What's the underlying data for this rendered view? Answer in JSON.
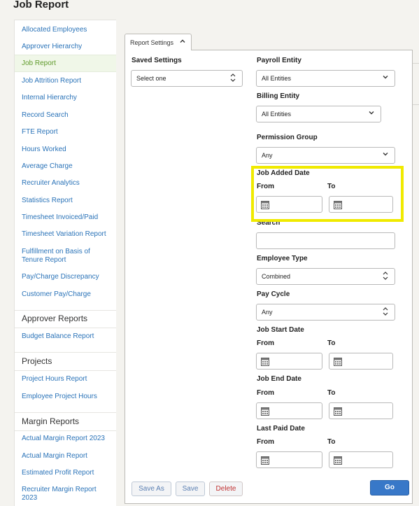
{
  "page": {
    "title": "Job Report"
  },
  "sidebar": {
    "items": [
      {
        "label": "Allocated Employees"
      },
      {
        "label": "Approver Hierarchy"
      },
      {
        "label": "Job Report"
      },
      {
        "label": "Job Attrition Report"
      },
      {
        "label": "Internal Hierarchy"
      },
      {
        "label": "Record Search"
      },
      {
        "label": "FTE Report"
      },
      {
        "label": "Hours Worked"
      },
      {
        "label": "Average Charge"
      },
      {
        "label": "Recruiter Analytics"
      },
      {
        "label": "Statistics Report"
      },
      {
        "label": "Timesheet Invoiced/Paid"
      },
      {
        "label": "Timesheet Variation Report"
      },
      {
        "label": "Fulfillment on Basis of Tenure Report"
      },
      {
        "label": "Pay/Charge Discrepancy"
      },
      {
        "label": "Customer Pay/Charge"
      },
      {
        "label": "Budget Balance Report"
      },
      {
        "label": "Project Hours Report"
      },
      {
        "label": "Employee Project Hours"
      },
      {
        "label": "Actual Margin Report 2023"
      },
      {
        "label": "Actual Margin Report"
      },
      {
        "label": "Estimated Profit Report"
      },
      {
        "label": "Recruiter Margin Report 2023"
      }
    ],
    "headings": [
      {
        "label": "Approver Reports"
      },
      {
        "label": "Projects"
      },
      {
        "label": "Margin Reports"
      }
    ],
    "active_color": "#5f9a2a",
    "link_color": "#2a73b8"
  },
  "tab": {
    "label": "Report Settings",
    "icon": "chevron-up-icon"
  },
  "form": {
    "saved_settings": {
      "label": "Saved Settings",
      "value": "Select one"
    },
    "payroll_entity": {
      "label": "Payroll Entity",
      "value": "All Entities"
    },
    "billing_entity": {
      "label": "Billing Entity",
      "value": "All Entities"
    },
    "permission_group": {
      "label": "Permission Group",
      "value": "Any"
    },
    "job_added_date": {
      "label": "Job Added Date",
      "from": "From",
      "to": "To"
    },
    "search": {
      "label": "Search",
      "value": ""
    },
    "employee_type": {
      "label": "Employee Type",
      "value": "Combined"
    },
    "pay_cycle": {
      "label": "Pay Cycle",
      "value": "Any"
    },
    "job_start_date": {
      "label": "Job Start Date",
      "from": "From",
      "to": "To"
    },
    "job_end_date": {
      "label": "Job End Date",
      "from": "From",
      "to": "To"
    },
    "last_paid_date": {
      "label": "Last Paid Date",
      "from": "From",
      "to": "To"
    }
  },
  "buttons": {
    "save_as": "Save As",
    "save": "Save",
    "delete": "Delete",
    "go": "Go"
  },
  "colors": {
    "highlight": "#f0ea00",
    "primary": "#3878c8",
    "danger": "#c03030"
  }
}
